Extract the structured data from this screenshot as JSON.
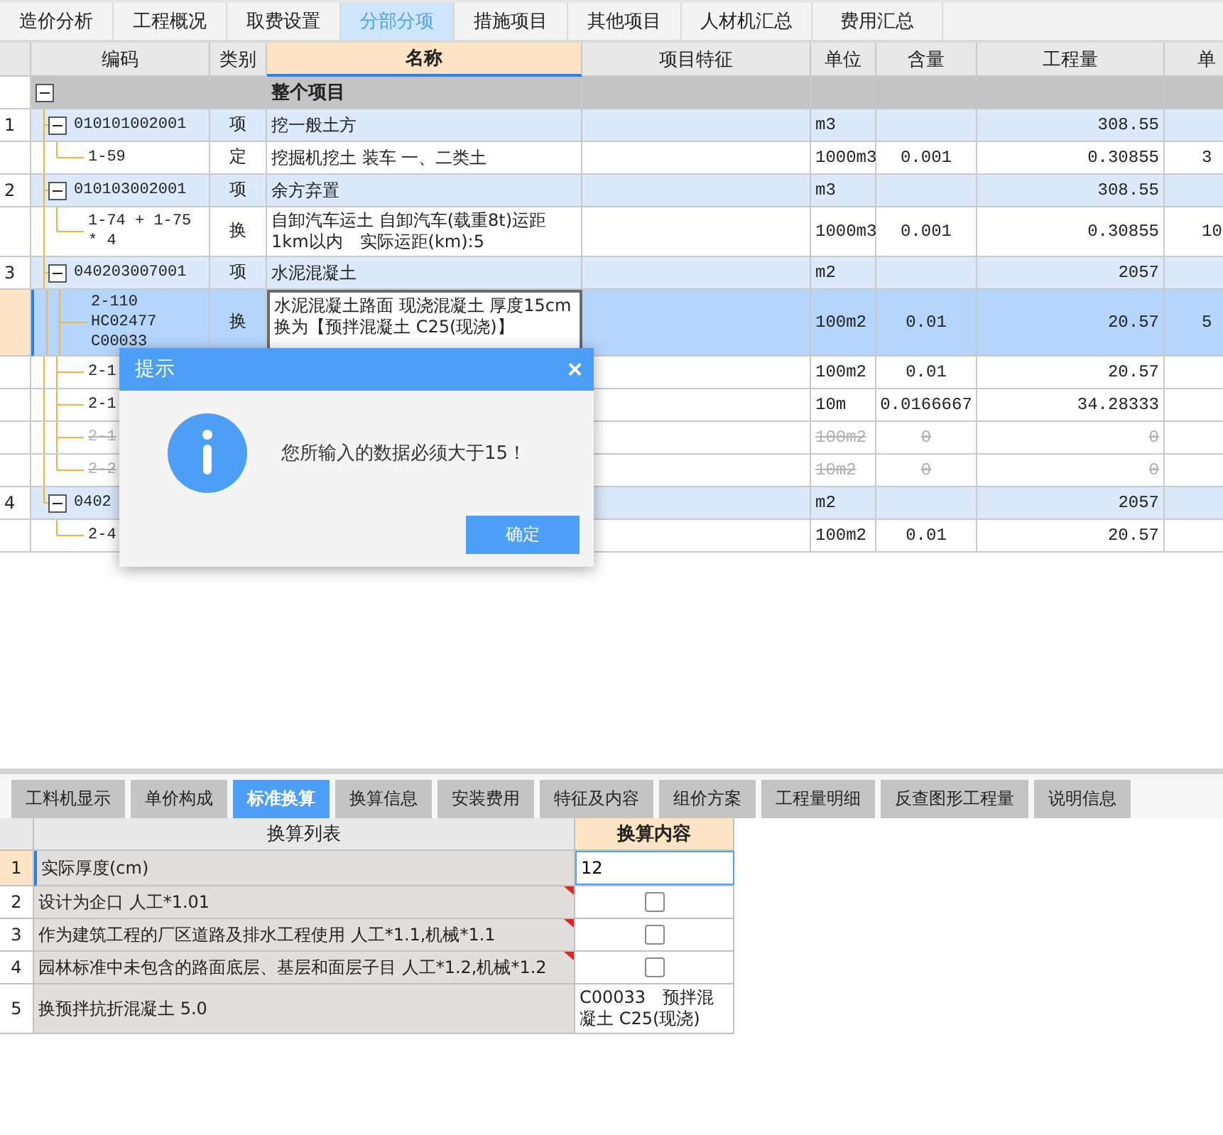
{
  "top_tabs": [
    {
      "label": "造价分析",
      "selected": false
    },
    {
      "label": "工程概况",
      "selected": false
    },
    {
      "label": "取费设置",
      "selected": false
    },
    {
      "label": "分部分项",
      "selected": true
    },
    {
      "label": "措施项目",
      "selected": false
    },
    {
      "label": "其他项目",
      "selected": false
    },
    {
      "label": "人材机汇总",
      "selected": false
    },
    {
      "label": "费用汇总",
      "selected": false
    }
  ],
  "grid": {
    "columns": [
      {
        "label": "编码",
        "selected": false
      },
      {
        "label": "类别",
        "selected": false
      },
      {
        "label": "名称",
        "selected": true
      },
      {
        "label": "项目特征",
        "selected": false
      },
      {
        "label": "单位",
        "selected": false
      },
      {
        "label": "含量",
        "selected": false
      },
      {
        "label": "工程量",
        "selected": false
      },
      {
        "label": "单",
        "selected": false
      }
    ],
    "root": {
      "name": "整个项目",
      "expanded": true,
      "children": [
        {
          "number": "1",
          "code": "010101002001",
          "category": "项",
          "name": "挖一般土方",
          "unit": "m3",
          "amount": "308.55",
          "expanded": true,
          "selected": false,
          "children": [
            {
              "code": "1-59",
              "category": "定",
              "name": "挖掘机挖土 装车 一、二类土",
              "unit": "1000m3",
              "content": "0.001",
              "amount": "0.30855",
              "column_9": "3",
              "selected": false,
              "disabled": false
            }
          ]
        },
        {
          "number": "2",
          "code": "010103002001",
          "category": "项",
          "name": "余方弃置",
          "unit": "m3",
          "amount": "308.55",
          "expanded": true,
          "selected": false,
          "children": [
            {
              "code": "1-74 + 1-75 * 4",
              "category": "换",
              "name": "自卸汽车运土 自卸汽车(载重8t)运距1km以内　实际运距(km):5",
              "unit": "1000m3",
              "content": "0.001",
              "amount": "0.30855",
              "column_9": "10",
              "selected": false,
              "disabled": false
            }
          ]
        },
        {
          "number": "3",
          "code": "040203007001",
          "category": "项",
          "name": "水泥混凝土",
          "unit": "m2",
          "amount": "2057",
          "expanded": true,
          "selected": false,
          "children": [
            {
              "code": "2-110 HC02477 C00033",
              "category": "换",
              "name": "水泥混凝土路面 现浇混凝土 厚度15cm 换为【预拌混凝土 C25(现浇)】",
              "unit": "100m2",
              "content": "0.01",
              "amount": "20.57",
              "column_9": "5",
              "selected": true,
              "disabled": false
            },
            {
              "code": "2-1",
              "unit": "100m2",
              "content": "0.01",
              "amount": "20.57",
              "selected": false,
              "disabled": false
            },
            {
              "code": "2-1",
              "unit": "10m",
              "content": "0.0166667",
              "amount": "34.28333",
              "selected": false,
              "disabled": false
            },
            {
              "code": "2-1",
              "unit": "100m2",
              "content": "0",
              "amount": "0",
              "selected": false,
              "disabled": true
            },
            {
              "code": "2-2",
              "unit": "10m2",
              "content": "0",
              "amount": "0",
              "selected": false,
              "disabled": true
            }
          ]
        },
        {
          "number": "4",
          "code": "0402",
          "unit": "m2",
          "amount": "2057",
          "expanded": true,
          "selected": false,
          "children": [
            {
              "code": "2-4",
              "unit": "100m2",
              "content": "0.01",
              "amount": "20.57",
              "selected": false,
              "disabled": false
            }
          ]
        }
      ]
    }
  },
  "dialog": {
    "title": "提示",
    "close": "×",
    "message": "您所输入的数据必须大于15！",
    "button": "确定"
  },
  "bottom_tabs": [
    {
      "label": "工料机显示",
      "selected": false
    },
    {
      "label": "单价构成",
      "selected": false
    },
    {
      "label": "标准换算",
      "selected": true
    },
    {
      "label": "换算信息",
      "selected": false
    },
    {
      "label": "安装费用",
      "selected": false
    },
    {
      "label": "特征及内容",
      "selected": false
    },
    {
      "label": "组价方案",
      "selected": false
    },
    {
      "label": "工程量明细",
      "selected": false
    },
    {
      "label": "反查图形工程量",
      "selected": false
    },
    {
      "label": "说明信息",
      "selected": false
    }
  ],
  "conversion": {
    "columns": [
      {
        "label": "换算列表",
        "selected": false
      },
      {
        "label": "换算内容",
        "selected": true
      }
    ],
    "rows": [
      {
        "number": "1",
        "name": "实际厚度(cm)",
        "kind": "input",
        "value": "12",
        "selected": true,
        "flagged": false
      },
      {
        "number": "2",
        "name": "设计为企口 人工*1.01",
        "kind": "checkbox",
        "checked": false,
        "selected": false,
        "flagged": true
      },
      {
        "number": "3",
        "name": "作为建筑工程的厂区道路及排水工程使用 人工*1.1,机械*1.1",
        "kind": "checkbox",
        "checked": false,
        "selected": false,
        "flagged": true
      },
      {
        "number": "4",
        "name": "园林标准中未包含的路面底层、基层和面层子目 人工*1.2,机械*1.2",
        "kind": "checkbox",
        "checked": false,
        "selected": false,
        "flagged": true
      },
      {
        "number": "5",
        "name": "换预拌抗折混凝土 5.0",
        "kind": "text",
        "value": "C00033　预拌混凝土 C25(现浇)",
        "selected": false,
        "flagged": false
      }
    ]
  }
}
